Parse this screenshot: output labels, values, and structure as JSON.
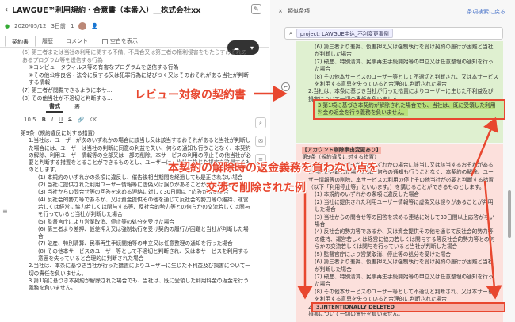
{
  "window": {
    "title": "LAWGUE™利用規約・合意書（本番入）＿株式会社xx"
  },
  "meta": {
    "date": "2020/05/12",
    "days": "3日前",
    "count": "1"
  },
  "tabs": [
    "契約書",
    "履歴",
    "コメント"
  ],
  "tab_checkbox_label": "空白を表示",
  "doc_top": [
    "(6) 第三者または当社の利用に関する不備、不具合又は第三者の権利侵害をもたらすおそれのあるプログラム等を送信する行為",
    "①コンピュータウィルス等の有害なプログラムを送信する行為",
    "②その他公序良俗・法令に反する又は犯罪行為に結びつく又はそのおそれがある当社が判断する情報",
    "(7) 第三者が閲覧できるように本サ…",
    "(8) その他当社が不適切と判断する…"
  ],
  "editor_tabs": [
    "書式",
    "表"
  ],
  "editor_toolbar": [
    "10.5",
    "B",
    "I",
    "U",
    "S"
  ],
  "doc_main": [
    {
      "lvl": 0,
      "text": "第9条（規約違反に対する措置）"
    },
    {
      "lvl": 1,
      "text": "1.当社は、ユーザーが次のいずれかの場合に該当し又は該当するおそれがあると当社が判断した場合には、ユーザーは当社の判断に同意の利益を失い、何らの通知も行うことなく、本契約の解除、利用ユーザー情報等の全部又は一部の削除、本サービスの利用の停止その他当社が必要と判断する措置をとることができるものとし、ユーザーは、当社に生じた損害を賠償するものとします。"
    },
    {
      "lvl": 2,
      "text": "(1) 本規約のいずれかの条項に違反し、催告後相当期間を経過しても是正されない場合"
    },
    {
      "lvl": 2,
      "text": "(2) 当社に提供された利用ユーザー情報等に虚偽又は誤りがあることが判明した場合"
    },
    {
      "lvl": 2,
      "text": "(3) 当社からの問合せ等の回答を求める連絡に対して30日間以上応答がない場合"
    },
    {
      "lvl": 2,
      "text": "(4) 反社会的勢力等であるか、又は資金提供その他を通じて反社会的勢力等の維持、運営若しくは経営に協力若しくは関与する等、反社会的勢力等との何らかの交流若しくは関与を行っていると当社が判断した場合"
    },
    {
      "lvl": 2,
      "text": "(5) 監督官庁により営業取消、停止等の処分を受けた場合"
    },
    {
      "lvl": 2,
      "text": "(6) 第三者より差押、仮差押え又は強制執行を受け契約の履行が困難と当社が判断した場合"
    },
    {
      "lvl": 2,
      "text": "(7) 破産、特別清算、民事再生手続開始等の申立又は任意整理の通知を行った場合"
    },
    {
      "lvl": 2,
      "text": "(8) その他本サービスのユーザー等として不適切と判断され、又は本サービスを利用する意思を失っていると合理的に判断された場合"
    },
    {
      "lvl": 1,
      "text": "2.当社は、本条に基づき当社が行った措置によりユーザーに生じた不利益及び損害について一切の責任を負いません。"
    },
    {
      "lvl": 1,
      "text": "3.第1項に基づき本契約が解除された場合でも、当社は、既に受領した利用料金の返金を行う義務を負いません。"
    }
  ],
  "panel": {
    "title": "類似条項",
    "back": "条項検索に戻る",
    "search_chip": "project: LAWGUE申込_不利変更事例",
    "close": "×"
  },
  "green_lines": [
    "(6) 第三者より差押、仮差押え又は強制執行を受け契約の履行が困難と当社が判断した場合",
    "(7) 破産、特別清算、民事再生手続開始等の申立又は任意整理の通知を行った場合",
    "(8) その他本サービスのユーザー等として不適切と判断され、又は本サービスを利用する意思を失っていると合理的に判断された場合",
    "2.当社は、本条に基づき当社が行った措置によりユーザーに生じた不利益及び損害について一切の責任を負いません。"
  ],
  "green_highlight": "3.第1項に基づき本契約が解除された場合でも、当社は、既に受領した利用料金の返金を行う義務を負いません。",
  "red_header": "【アカウント削除事由変更あり】",
  "red_lines": [
    "第9条（規約違反に対する措置）",
    "1.当社は、ユーザーが次のいずれかの場合に該当し又は該当するおそれがあると当社が判断した場合には、何らの通知も行うことなく、本契約の解除、ユーザー情報等の削除、本サービスの利用の停止その他当社が必要と判断する措置（以下「利用停止等」といいます。）を講じることができるものとします。",
    "(1) 本規約のいずれかの条項に違反した場合",
    "(2) 当社に提供された利用ユーザー情報等に虚偽又は誤りがあることが判明した場合",
    "(3) 当社からの問合せ等の回答を求める連絡に対して30日間以上応答がない場合",
    "(4) 反社会的勢力等であるか、又は資金提供その他を通じて反社会的勢力等の維持、運営若しくは経営に協力若しくは関与する等反社会的勢力等との何らかの交流若しくは関与を行っていると当社が判断した場合",
    "(5) 監督官庁により営業取消、停止等の処分を受けた場合",
    "(6) 第三者より差押、仮差押え又は強制執行を受け契約の履行が困難と当社が判断した場合",
    "(7) 破産、特別清算、民事再生手続開始等の申立又は任意整理の通知を行った場合",
    "(8) その他本サービスのユーザー等として不適切と判断され、又は本サービスを利用する意思を失っていると合理的に判断された場合",
    "2.当社は、本条に基づき当社が行った措置によりユーザーに生じた不利益及び損害について一切の責任を負いません。"
  ],
  "red_highlight": "3.INTENTIONALLY DELETED",
  "annotations": {
    "a1": "レビュー対象の契約書",
    "a2": "本契約の解除時の返金義務を負わない点を",
    "a3": "交渉で削除された例"
  },
  "colors": {
    "annotation": "#e8472f",
    "green": "#dff0d0",
    "red": "#fce0dc"
  }
}
